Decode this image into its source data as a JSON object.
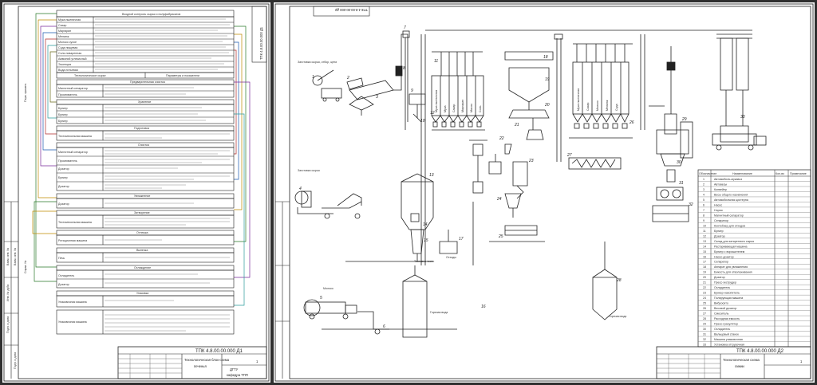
{
  "sheet1": {
    "stamp_code": "ТПК 4.8.00.00.000 Д1",
    "title": "Технологическая блок-схема",
    "subtitle": "печенья",
    "org_1": "ДГТУ",
    "org_2": "кафедра ТПП",
    "sheet_count": "1",
    "tab_texts": [
      "Взам. инв. №",
      "Инв. № дубл.",
      "Подп. и дата"
    ],
    "side_labels": [
      "Справ. №",
      "Перв. примен."
    ],
    "headers": [
      "Входной контроль сырья и полуфабрикатов",
      "Технологическое сырье",
      "Параметры и показатели",
      "Предварительная очистка",
      "Хранение",
      "Подготовка",
      "Очистка",
      "Увлажнение",
      "Затворение",
      "Отлежка",
      "Выпечка",
      "Охлаждение",
      "Упаковка"
    ],
    "raw_materials": [
      "Мука пшеничная",
      "Сахар",
      "Маргарин",
      "Меланж",
      "Молоко сухое",
      "Сода пищевая",
      "Соль поваренная",
      "Аммоний углекислый",
      "Эссенция",
      "Вода питьевая",
      "Жир кондитерский"
    ],
    "process_steps": [
      "Магнитный сепаратор",
      "Просеиватель",
      "Бункер",
      "Дозатор",
      "Тестомесильная машина",
      "Ротационная машина",
      "Печь",
      "Охладитель",
      "Упаковочная машина"
    ]
  },
  "sheet2": {
    "stamp_code": "ТПК 4.8.00.00.000 Д2",
    "title": "Технологическая схема",
    "subtitle": "линии",
    "sheet_count": "1",
    "labels": [
      "Заготовка сырья, отбор, цепи",
      "Заготовка сырья",
      "Молоко",
      "Горячая вода",
      "Горячая вода",
      "Тестовое тесто",
      "Отходы"
    ],
    "bin_labels_a": [
      "Мука пшеничная",
      "Мука",
      "Сахар",
      "Маргарин",
      "Масло",
      "Соль"
    ],
    "bin_labels_b": [
      "Мука пшеничная",
      "Сахар",
      "Молоко",
      "Меланж",
      "Сода"
    ],
    "spec_header": [
      "Обозначение",
      "Наименование",
      "Кол-во",
      "Примечание"
    ],
    "spec_items": [
      {
        "n": "1",
        "name": "Автомобиль-мукавоз"
      },
      {
        "n": "2",
        "name": "Автовесы"
      },
      {
        "n": "3",
        "name": "Конвейер"
      },
      {
        "n": "4",
        "name": "Весы общего назначения"
      },
      {
        "n": "5",
        "name": "Автомобильная цистерна"
      },
      {
        "n": "6",
        "name": "Насос"
      },
      {
        "n": "7",
        "name": "Нория"
      },
      {
        "n": "8",
        "name": "Магнитный сепаратор"
      },
      {
        "n": "9",
        "name": "Сепаратор"
      },
      {
        "n": "10",
        "name": "Контейнер для отходов"
      },
      {
        "n": "11",
        "name": "Бункер"
      },
      {
        "n": "12",
        "name": "Дозатор"
      },
      {
        "n": "13",
        "name": "Склад для затаренного сырья"
      },
      {
        "n": "14",
        "name": "Растаривающая машина"
      },
      {
        "n": "15",
        "name": "Бункер с ворошителем"
      },
      {
        "n": "16",
        "name": "Насос-дозатор"
      },
      {
        "n": "17",
        "name": "Сепаратор"
      },
      {
        "n": "18",
        "name": "Аппарат для увлажнения"
      },
      {
        "n": "19",
        "name": "Емкость для отволаживания"
      },
      {
        "n": "20",
        "name": "Дозатор"
      },
      {
        "n": "21",
        "name": "Пресс-экструдер"
      },
      {
        "n": "22",
        "name": "Охладитель"
      },
      {
        "n": "23",
        "name": "Бункер-накопитель"
      },
      {
        "n": "24",
        "name": "Полирующая машина"
      },
      {
        "n": "25",
        "name": "Вибросито"
      },
      {
        "n": "26",
        "name": "Весовой дозатор"
      },
      {
        "n": "27",
        "name": "Смеситель"
      },
      {
        "n": "28",
        "name": "Расходная емкость"
      },
      {
        "n": "29",
        "name": "Пресс-гранулятор"
      },
      {
        "n": "30",
        "name": "Охладитель"
      },
      {
        "n": "31",
        "name": "Вальцовый станок"
      },
      {
        "n": "32",
        "name": "Машина упаковочная"
      },
      {
        "n": "33",
        "name": "Установка отгрузочная"
      }
    ]
  }
}
